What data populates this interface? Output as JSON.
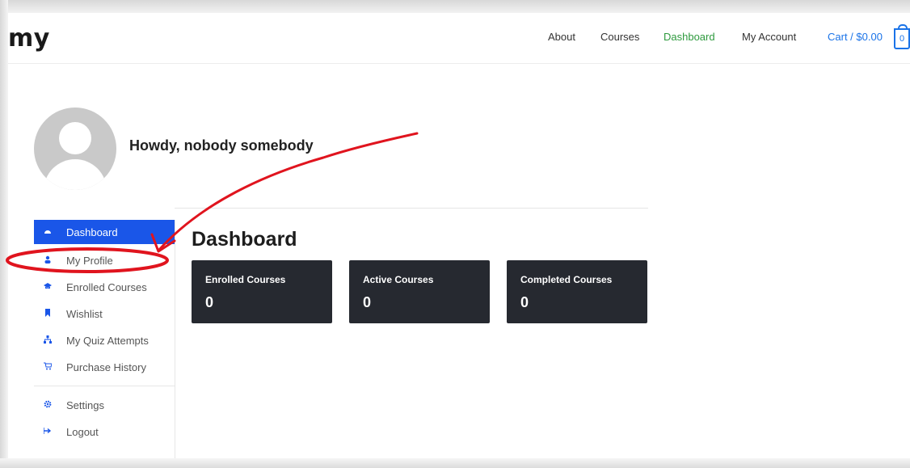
{
  "header": {
    "logo": "my",
    "nav": [
      "About",
      "Courses",
      "Dashboard",
      "My Account"
    ],
    "active_nav": "Dashboard",
    "cart_label": "Cart / $0.00",
    "cart_count": "0"
  },
  "profile": {
    "greeting": "Howdy, nobody somebody"
  },
  "sidebar": {
    "items": [
      {
        "label": "Dashboard",
        "icon": "dashboard-icon",
        "active": true
      },
      {
        "label": "My Profile",
        "icon": "user-icon"
      },
      {
        "label": "Enrolled Courses",
        "icon": "graduation-cap-icon"
      },
      {
        "label": "Wishlist",
        "icon": "bookmark-icon"
      },
      {
        "label": "My Quiz Attempts",
        "icon": "quiz-icon"
      },
      {
        "label": "Purchase History",
        "icon": "cart-icon"
      },
      {
        "label": "Settings",
        "icon": "gear-icon"
      },
      {
        "label": "Logout",
        "icon": "logout-icon"
      }
    ]
  },
  "main": {
    "title": "Dashboard",
    "cards": [
      {
        "title": "Enrolled Courses",
        "value": "0"
      },
      {
        "title": "Active Courses",
        "value": "0"
      },
      {
        "title": "Completed Courses",
        "value": "0"
      }
    ]
  },
  "colors": {
    "accent": "#1a56e8",
    "active_nav": "#2e9a3e",
    "card_bg": "#262930",
    "annotation": "#e0141e"
  }
}
